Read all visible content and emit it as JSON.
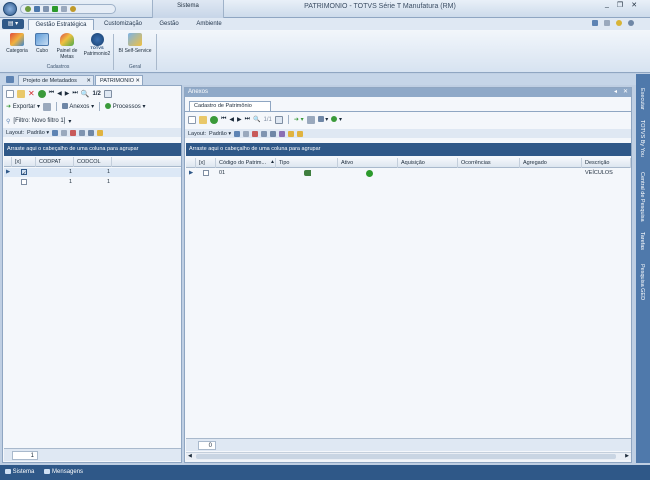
{
  "title_bar": {
    "tab_sistema": "Sistema",
    "title": "PATRIMONIO - TOTVS Série T Manufatura (RM)"
  },
  "menu_tabs": [
    "Gestão Estratégica",
    "Customização",
    "Gestão",
    "Ambiente"
  ],
  "ribbon": {
    "items": [
      {
        "label": "Categoria"
      },
      {
        "label": "Cubo"
      },
      {
        "label": "Painel de Metas"
      },
      {
        "label": "Patrimonio2"
      },
      {
        "label": "BI Self-Service"
      }
    ],
    "logo_text": "TOTVS",
    "group_cadastros": "Cadastros",
    "group_geral": "Geral"
  },
  "doc_tabs": [
    "Projeto de Metadados",
    "PATRIMONIO"
  ],
  "left_panel": {
    "page": "1/2",
    "export_label": "Exportar",
    "anexos_label": "Anexos",
    "processos_label": "Processos",
    "filter_label": "[Filtro: Novo filtro 1]",
    "layout_label": "Layout:",
    "layout_value": "Padrão",
    "group_band": "Arraste aqui o cabeçalho de uma coluna para agrupar",
    "columns": [
      "[x]",
      "CODPAT",
      "CODCOL"
    ],
    "rows": [
      {
        "codpat": "1",
        "codcol": "1"
      },
      {
        "codpat": "1",
        "codcol": "1"
      }
    ],
    "footer_value": "1"
  },
  "right_panel": {
    "header": "Anexos",
    "tab": "Cadastro de Patrimônio",
    "page": "1/1",
    "layout_label": "Layout:",
    "layout_value": "Padrão",
    "group_band": "Arraste aqui o cabeçalho de uma coluna para agrupar",
    "columns": [
      "[x]",
      "Código do Patrim...",
      "Tipo",
      "Ativo",
      "Aquisição",
      "Ocorrências",
      "Agregado",
      "Descrição"
    ],
    "rows": [
      {
        "codigo": "01",
        "descricao": "VEÍCULOS"
      }
    ],
    "footer_value": "0"
  },
  "side_bar": [
    "Executar",
    "TOTVS By You",
    "Central de Pesquisa",
    "Tarefas",
    "Pesquisa GED"
  ],
  "status_bar": [
    "Sistema",
    "Mensagens"
  ],
  "colors": {
    "accent": "#2f5888",
    "sidebar": "#4f79ab",
    "active_green": "#2c9a2c"
  }
}
